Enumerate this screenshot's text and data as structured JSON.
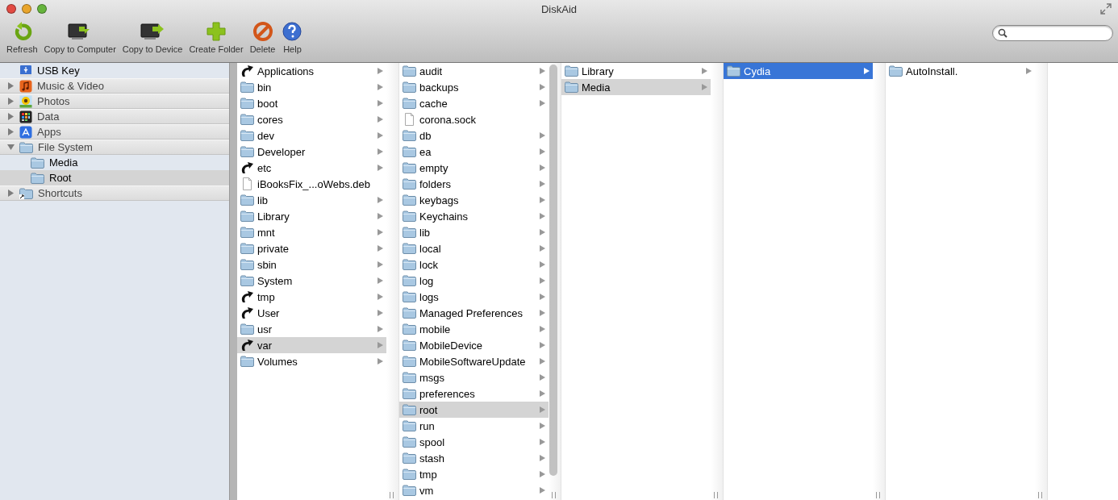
{
  "window": {
    "title": "DiskAid"
  },
  "toolbar": [
    {
      "label": "Refresh",
      "kind": "refresh"
    },
    {
      "label": "Copy to Computer",
      "kind": "to-computer"
    },
    {
      "label": "Copy to Device",
      "kind": "to-device"
    },
    {
      "label": "Create Folder",
      "kind": "create"
    },
    {
      "label": "Delete",
      "kind": "delete"
    },
    {
      "label": "Help",
      "kind": "help"
    }
  ],
  "sidebar": {
    "items": [
      {
        "label": "USB Key",
        "kind": "usb",
        "selected": false
      },
      {
        "label": "Music & Video",
        "kind": "music",
        "expanded": false,
        "selected": false
      },
      {
        "label": "Photos",
        "kind": "photos",
        "expanded": false,
        "selected": false
      },
      {
        "label": "Data",
        "kind": "data",
        "expanded": false,
        "selected": false
      },
      {
        "label": "Apps",
        "kind": "apps",
        "expanded": false,
        "selected": false
      },
      {
        "label": "File System",
        "kind": "folder",
        "expanded": true,
        "selected": false,
        "children": [
          {
            "label": "Media",
            "selected": false
          },
          {
            "label": "Root",
            "selected": true
          }
        ]
      },
      {
        "label": "Shortcuts",
        "kind": "shortcut",
        "expanded": false,
        "selected": false
      }
    ]
  },
  "columns": [
    {
      "focused": false,
      "items": [
        {
          "name": "Applications",
          "kind": "alias",
          "selected": false
        },
        {
          "name": "bin",
          "kind": "folder",
          "selected": false
        },
        {
          "name": "boot",
          "kind": "folder",
          "selected": false
        },
        {
          "name": "cores",
          "kind": "folder",
          "selected": false
        },
        {
          "name": "dev",
          "kind": "folder",
          "selected": false
        },
        {
          "name": "Developer",
          "kind": "folder",
          "selected": false
        },
        {
          "name": "etc",
          "kind": "alias",
          "selected": false
        },
        {
          "name": "iBooksFix_...oWebs.deb",
          "kind": "file",
          "selected": false
        },
        {
          "name": "lib",
          "kind": "folder",
          "selected": false
        },
        {
          "name": "Library",
          "kind": "folder",
          "selected": false
        },
        {
          "name": "mnt",
          "kind": "folder",
          "selected": false
        },
        {
          "name": "private",
          "kind": "folder",
          "selected": false
        },
        {
          "name": "sbin",
          "kind": "folder",
          "selected": false
        },
        {
          "name": "System",
          "kind": "folder",
          "selected": false
        },
        {
          "name": "tmp",
          "kind": "alias",
          "selected": false
        },
        {
          "name": "User",
          "kind": "alias",
          "selected": false
        },
        {
          "name": "usr",
          "kind": "folder",
          "selected": false
        },
        {
          "name": "var",
          "kind": "alias",
          "selected": true
        },
        {
          "name": "Volumes",
          "kind": "folder",
          "selected": false
        }
      ]
    },
    {
      "focused": false,
      "scrollbar": true,
      "items": [
        {
          "name": "audit",
          "kind": "folder",
          "selected": false
        },
        {
          "name": "backups",
          "kind": "folder",
          "selected": false
        },
        {
          "name": "cache",
          "kind": "folder",
          "selected": false
        },
        {
          "name": "corona.sock",
          "kind": "file",
          "selected": false
        },
        {
          "name": "db",
          "kind": "folder",
          "selected": false
        },
        {
          "name": "ea",
          "kind": "folder",
          "selected": false
        },
        {
          "name": "empty",
          "kind": "folder",
          "selected": false
        },
        {
          "name": "folders",
          "kind": "folder",
          "selected": false
        },
        {
          "name": "keybags",
          "kind": "folder",
          "selected": false
        },
        {
          "name": "Keychains",
          "kind": "folder",
          "selected": false
        },
        {
          "name": "lib",
          "kind": "folder",
          "selected": false
        },
        {
          "name": "local",
          "kind": "folder",
          "selected": false
        },
        {
          "name": "lock",
          "kind": "folder",
          "selected": false
        },
        {
          "name": "log",
          "kind": "folder",
          "selected": false
        },
        {
          "name": "logs",
          "kind": "folder",
          "selected": false
        },
        {
          "name": "Managed Preferences",
          "kind": "folder",
          "selected": false
        },
        {
          "name": "mobile",
          "kind": "folder",
          "selected": false
        },
        {
          "name": "MobileDevice",
          "kind": "folder",
          "selected": false
        },
        {
          "name": "MobileSoftwareUpdate",
          "kind": "folder",
          "selected": false
        },
        {
          "name": "msgs",
          "kind": "folder",
          "selected": false
        },
        {
          "name": "preferences",
          "kind": "folder",
          "selected": false
        },
        {
          "name": "root",
          "kind": "folder",
          "selected": true
        },
        {
          "name": "run",
          "kind": "folder",
          "selected": false
        },
        {
          "name": "spool",
          "kind": "folder",
          "selected": false
        },
        {
          "name": "stash",
          "kind": "folder",
          "selected": false
        },
        {
          "name": "tmp",
          "kind": "folder",
          "selected": false
        },
        {
          "name": "vm",
          "kind": "folder",
          "selected": false
        }
      ]
    },
    {
      "focused": false,
      "items": [
        {
          "name": "Library",
          "kind": "folder",
          "selected": false
        },
        {
          "name": "Media",
          "kind": "folder",
          "selected": true
        }
      ]
    },
    {
      "focused": true,
      "items": [
        {
          "name": "Cydia",
          "kind": "folder",
          "selected": true
        }
      ]
    },
    {
      "items": [
        {
          "name": "AutoInstall.",
          "kind": "folder",
          "selected": false
        }
      ]
    }
  ]
}
